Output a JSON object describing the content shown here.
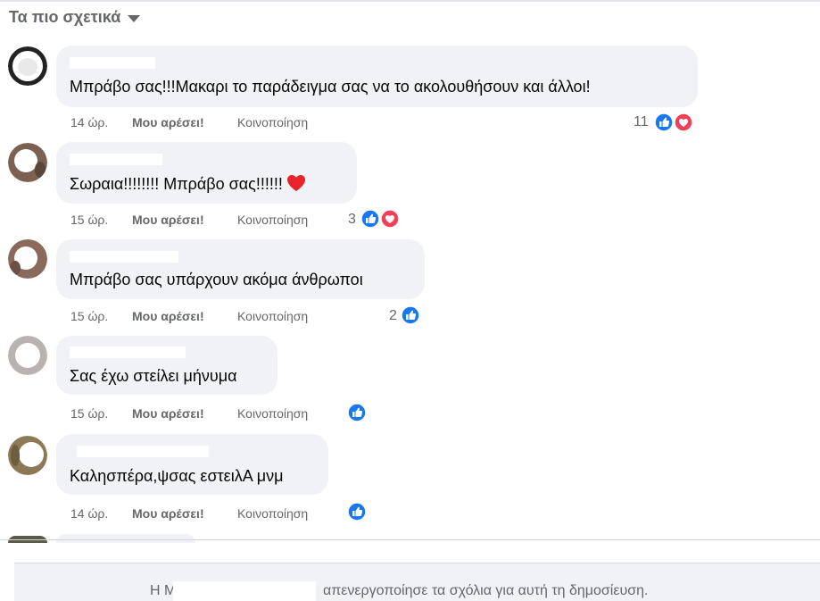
{
  "sort": {
    "label": "Τα πιο σχετικά"
  },
  "comments": [
    {
      "text": "Μπράβο σας!!!Μακαρι το παράδειγμα σας να το ακολουθήσουν και άλλοι!",
      "time": "14 ώρ.",
      "like": "Μου αρέσει!",
      "share": "Κοινοποίηση",
      "reactions_count": "11",
      "reactions": [
        "like-icon",
        "love-icon"
      ],
      "name_fragment": ""
    },
    {
      "text": "Σωραια!!!!!!!! Μπράβο σας!!!!!!",
      "time": "15 ώρ.",
      "like": "Μου αρέσει!",
      "share": "Κοινοποίηση",
      "reactions_count": "3",
      "reactions": [
        "like-icon",
        "love-icon"
      ],
      "name_fragment": ""
    },
    {
      "text": "Μπράβο σας υπάρχουν ακόμα άνθρωποι",
      "time": "15 ώρ.",
      "like": "Μου αρέσει!",
      "share": "Κοινοποίηση",
      "reactions_count": "2",
      "reactions": [
        "like-icon"
      ],
      "name_fragment": ""
    },
    {
      "text": "Σας έχω στείλει μήνυμα",
      "time": "15 ώρ.",
      "like": "Μου αρέσει!",
      "share": "Κοινοποίηση",
      "reactions_count": "",
      "reactions": [
        "like-icon"
      ],
      "name_fragment": ""
    },
    {
      "text": "Καλησπέρα,ψσας εστειλΑ μνμ",
      "time": "14 ώρ.",
      "like": "Μου αρέσει!",
      "share": "Κοινοποίηση",
      "reactions_count": "",
      "reactions": [
        "like-icon"
      ],
      "name_fragment": ""
    }
  ],
  "footer": {
    "prefix": "Η Μ",
    "message": "απενεργοποίησε τα σχόλια για αυτή τη δημοσίευση."
  },
  "colors": {
    "like_blue": "#1877f2",
    "love_red": "#f33e58",
    "bubble": "#f0f2f5",
    "muted": "#65676b"
  }
}
